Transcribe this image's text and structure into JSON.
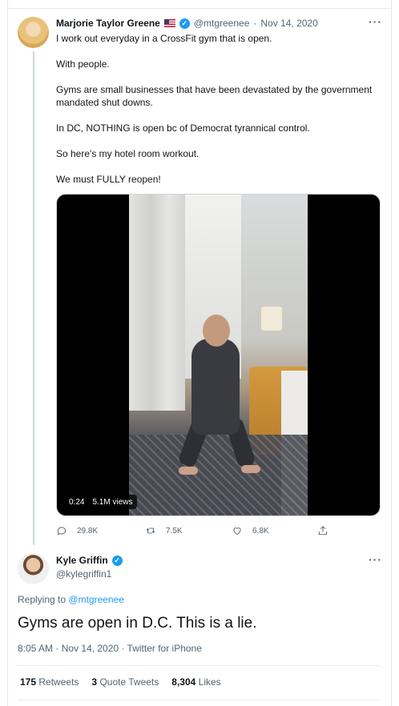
{
  "tweet1": {
    "name": "Marjorie Taylor Greene",
    "handle": "@mtgreenee",
    "separator": "·",
    "date": "Nov 14, 2020",
    "lines": [
      "I work out everyday in a CrossFit gym that is open.",
      "With people.",
      "Gyms are small businesses that have been devastated by the government mandated shut downs.",
      "In DC, NOTHING is open bc of Democrat tyrannical control.",
      "So here's my hotel room workout.",
      "We must FULLY reopen!"
    ],
    "video": {
      "duration": "0:24",
      "views": "5.1M views"
    },
    "actions": {
      "replies": "29.8K",
      "retweets": "7.5K",
      "likes": "6.8K"
    },
    "more": "···"
  },
  "tweet2": {
    "name": "Kyle Griffin",
    "handle": "@kylegriffin1",
    "replying_label": "Replying to",
    "replying_to": "@mtgreenee",
    "text": "Gyms are open in D.C. This is a lie.",
    "meta": "8:05 AM · Nov 14, 2020 · Twitter for iPhone",
    "stats": {
      "retweets_count": "175",
      "retweets_label": "Retweets",
      "quotes_count": "3",
      "quotes_label": "Quote Tweets",
      "likes_count": "8,304",
      "likes_label": "Likes"
    },
    "more": "···"
  },
  "icons": {
    "verified": "verified-badge-icon",
    "flag": "us-flag-icon",
    "reply": "reply-icon",
    "retweet": "retweet-icon",
    "like": "heart-icon",
    "share": "share-icon"
  },
  "colors": {
    "accent": "#1d9bf0",
    "muted": "#536471",
    "text": "#0f1419"
  }
}
